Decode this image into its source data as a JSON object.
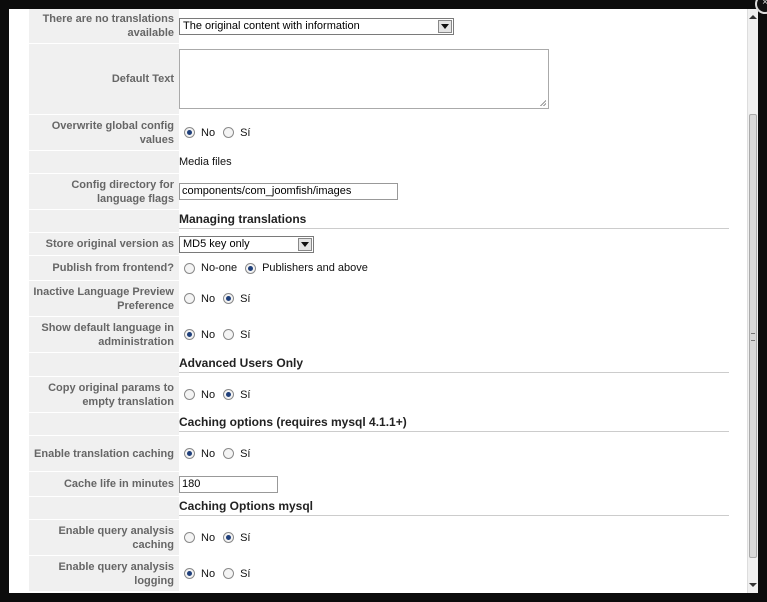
{
  "rows": {
    "no_translations": {
      "label": "There are no translations available",
      "value": "The original content with information"
    },
    "default_text": {
      "label": "Default Text",
      "value": ""
    },
    "overwrite_global": {
      "label": "Overwrite global config values",
      "options": [
        "No",
        "Sí"
      ],
      "selected": "No"
    },
    "media_files": {
      "text": "Media files"
    },
    "config_dir": {
      "label": "Config directory for language flags",
      "value": "components/com_joomfish/images"
    },
    "managing_translations": {
      "title": "Managing translations"
    },
    "store_original": {
      "label": "Store original version as",
      "value": "MD5 key only"
    },
    "publish_frontend": {
      "label": "Publish from frontend?",
      "options": [
        "No-one",
        "Publishers and above"
      ],
      "selected": "Publishers and above"
    },
    "inactive_preview": {
      "label": "Inactive Language Preview Preference",
      "options": [
        "No",
        "Sí"
      ],
      "selected": "Sí"
    },
    "show_default_lang": {
      "label": "Show default language in administration",
      "options": [
        "No",
        "Sí"
      ],
      "selected": "No"
    },
    "advanced_users": {
      "title": "Advanced Users Only"
    },
    "copy_params": {
      "label": "Copy original params to empty translation",
      "options": [
        "No",
        "Sí"
      ],
      "selected": "Sí"
    },
    "caching_options": {
      "title": "Caching options (requires mysql 4.1.1+)"
    },
    "enable_caching": {
      "label": "Enable translation caching",
      "options": [
        "No",
        "Sí"
      ],
      "selected": "No"
    },
    "cache_life": {
      "label": "Cache life in minutes",
      "value": "180"
    },
    "caching_mysql": {
      "title": "Caching Options mysql"
    },
    "query_analysis_caching": {
      "label": "Enable query analysis caching",
      "options": [
        "No",
        "Sí"
      ],
      "selected": "Sí"
    },
    "query_analysis_logging": {
      "label": "Enable query analysis logging",
      "options": [
        "No",
        "Sí"
      ],
      "selected": "No"
    }
  },
  "icons": {
    "close": "close-icon",
    "dropdown": "chevron-down-icon",
    "scroll_up": "arrow-up-icon",
    "scroll_down": "arrow-down-icon"
  }
}
